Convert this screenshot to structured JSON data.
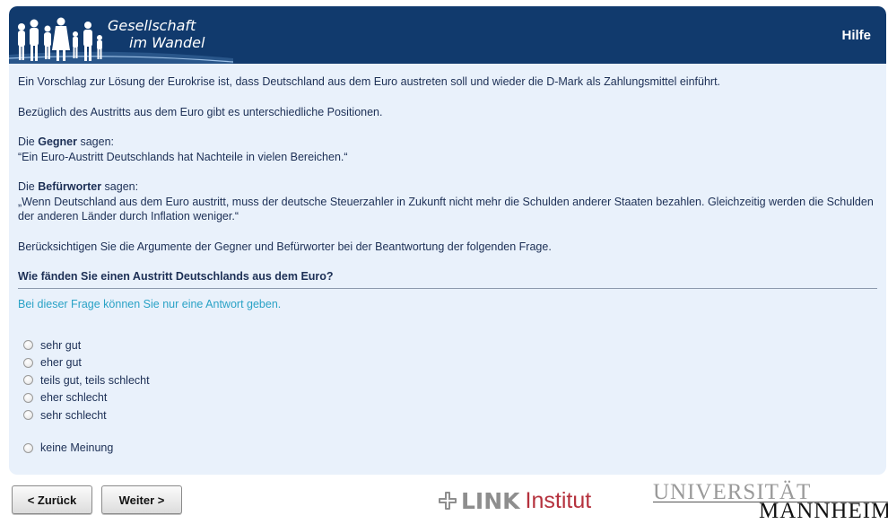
{
  "header": {
    "brand_line1": "Gesellschaft",
    "brand_line2": "im Wandel",
    "help_label": "Hilfe"
  },
  "intro": {
    "p1": "Ein Vorschlag zur Lösung der Eurokrise ist, dass Deutschland aus dem Euro austreten soll und wieder die D-Mark als Zahlungsmittel einführt.",
    "p2": "Bezüglich des Austritts aus dem Euro gibt es unterschiedliche Positionen.",
    "opponents_prefix": "Die ",
    "opponents_label": "Gegner",
    "opponents_suffix": " sagen:",
    "opponents_quote": "“Ein Euro-Austritt Deutschlands hat Nachteile in vielen Bereichen.“",
    "supporters_prefix": "Die ",
    "supporters_label": "Befürworter",
    "supporters_suffix": " sagen:",
    "supporters_quote": "„Wenn Deutschland aus dem Euro austritt, muss der deutsche Steuerzahler in Zukunft nicht mehr die Schulden anderer Staaten bezahlen. Gleichzeitig werden die Schulden der anderen Länder durch Inflation weniger.“",
    "consider": "Berücksichtigen Sie die Argumente der Gegner und Befürworter bei der Beantwortung der folgenden Frage."
  },
  "question": {
    "text": "Wie fänden Sie einen Austritt Deutschlands aus dem Euro?",
    "hint": "Bei dieser Frage können Sie nur eine Antwort geben.",
    "options": [
      "sehr gut",
      "eher gut",
      "teils gut, teils schlecht",
      "eher schlecht",
      "sehr schlecht",
      "keine Meinung"
    ]
  },
  "nav": {
    "back_label": "< Zurück",
    "next_label": "Weiter >"
  },
  "footer": {
    "link_word": "LINK",
    "link_institut": "Institut",
    "uni_top": "UNIVERSITÄT",
    "uni_bottom": "MANNHEIM"
  },
  "colors": {
    "header_bg": "#113a6d",
    "panel_bg": "#e9f1fb",
    "text": "#1c2f55",
    "hint": "#2aa2c6",
    "link_red": "#b5313d"
  }
}
